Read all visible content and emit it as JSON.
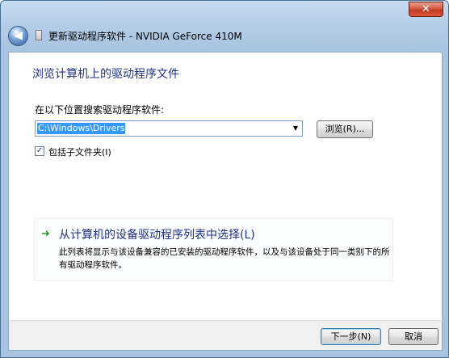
{
  "window": {
    "title": "更新驱动程序软件 - NVIDIA GeForce 410M",
    "close_symbol": "✕",
    "back_symbol": "◀"
  },
  "content": {
    "heading": "浏览计算机上的驱动程序文件",
    "search_label": "在以下位置搜索驱动程序软件:",
    "path_value": "C:\\Windows\\Drivers",
    "browse_label": "浏览(R)...",
    "include_subfolders_checked": true,
    "include_subfolders_label": "包括子文件夹(I)",
    "pick_title": "从计算机的设备驱动程序列表中选择(L)",
    "pick_description": "此列表将显示与该设备兼容的已安装的驱动程序软件，以及与该设备处于同一类别下的所有驱动程序软件。"
  },
  "footer": {
    "next_label": "下一步(N)",
    "cancel_label": "取消"
  },
  "icons": {
    "close": "close-icon",
    "back": "back-arrow-icon",
    "device": "device-icon",
    "dropdown": "chevron-down-icon",
    "check": "check-icon",
    "green_arrow": "green-arrow-icon"
  },
  "colors": {
    "heading": "#1e3287",
    "selection": "#3399ff",
    "green_arrow": "#2c9b2c",
    "close_button": "#c23a21"
  }
}
